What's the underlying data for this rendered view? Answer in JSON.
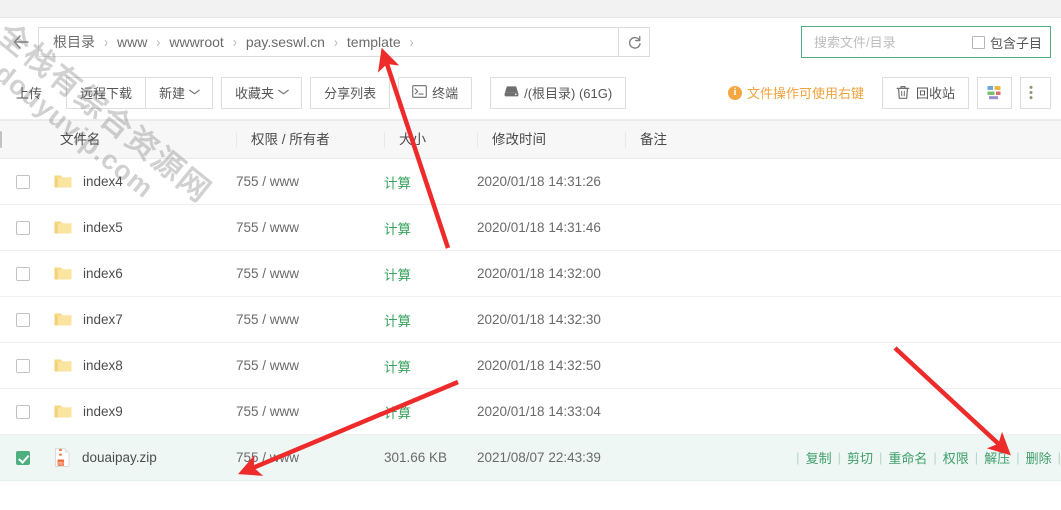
{
  "breadcrumb": {
    "back_icon": "back-arrow-icon",
    "items": [
      "根目录",
      "www",
      "wwwroot",
      "pay.seswl.cn",
      "template"
    ],
    "separator": "›",
    "refresh_icon": "refresh-icon"
  },
  "search": {
    "placeholder": "搜索文件/目录",
    "value": "",
    "subdir_label": "包含子目",
    "border_color": "#4caf7d"
  },
  "toolbar": {
    "upload": "上传",
    "remote_download": "远程下载",
    "new": "新建",
    "favorites": "收藏夹",
    "share_list": "分享列表",
    "terminal": "终端",
    "disk": "/(根目录) (61G)",
    "hint": "文件操作可使用右键",
    "recycle_bin": "回收站",
    "caret": "⌄",
    "hint_color": "#f0a23c"
  },
  "table": {
    "headers": [
      "文件名",
      "权限 / 所有者",
      "大小",
      "修改时间",
      "备注"
    ],
    "rows": [
      {
        "name": "index4",
        "type": "folder",
        "perm": "755 / www",
        "size": "计算",
        "size_is_link": true,
        "time": "2020/01/18 14:31:26",
        "note": "",
        "selected": false
      },
      {
        "name": "index5",
        "type": "folder",
        "perm": "755 / www",
        "size": "计算",
        "size_is_link": true,
        "time": "2020/01/18 14:31:46",
        "note": "",
        "selected": false
      },
      {
        "name": "index6",
        "type": "folder",
        "perm": "755 / www",
        "size": "计算",
        "size_is_link": true,
        "time": "2020/01/18 14:32:00",
        "note": "",
        "selected": false
      },
      {
        "name": "index7",
        "type": "folder",
        "perm": "755 / www",
        "size": "计算",
        "size_is_link": true,
        "time": "2020/01/18 14:32:30",
        "note": "",
        "selected": false
      },
      {
        "name": "index8",
        "type": "folder",
        "perm": "755 / www",
        "size": "计算",
        "size_is_link": true,
        "time": "2020/01/18 14:32:50",
        "note": "",
        "selected": false
      },
      {
        "name": "index9",
        "type": "folder",
        "perm": "755 / www",
        "size": "计算",
        "size_is_link": true,
        "time": "2020/01/18 14:33:04",
        "note": "",
        "selected": false
      },
      {
        "name": "douaipay.zip",
        "type": "zip",
        "perm": "755 / www",
        "size": "301.66 KB",
        "size_is_link": false,
        "time": "2021/08/07 22:43:39",
        "note": "",
        "selected": true
      }
    ],
    "row_actions": [
      "复制",
      "剪切",
      "重命名",
      "权限",
      "解压",
      "删除"
    ],
    "selected_row_bg": "#eef7f4",
    "link_color": "#3f9e6a"
  },
  "watermark": {
    "line1": "全栈有综合资源网",
    "line2": "douyuvip.com"
  },
  "annotations": {
    "arrow_color": "#ee2b2b",
    "count": 3
  }
}
